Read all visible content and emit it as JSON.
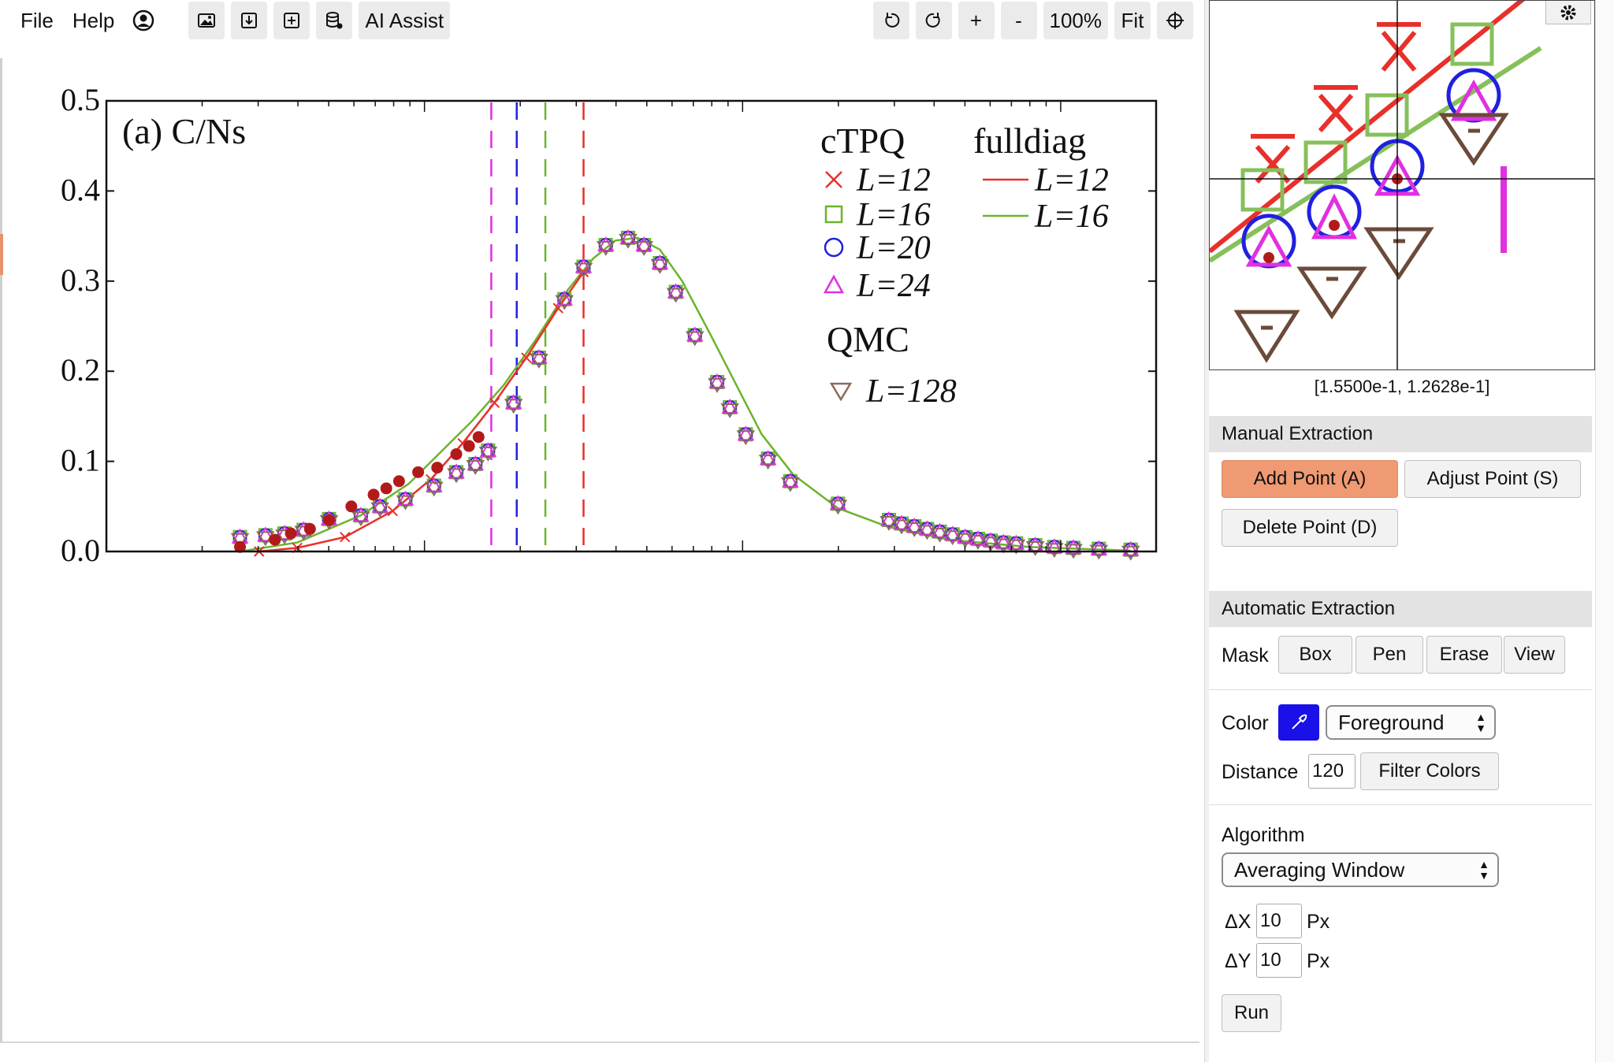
{
  "menu": {
    "file": "File",
    "help": "Help"
  },
  "toolbar": {
    "icons": [
      "account-icon",
      "image-icon",
      "import-icon",
      "add-dataset-icon",
      "dataset-settings-icon"
    ],
    "ai_assist": "AI Assist",
    "undo_icon": "undo-icon",
    "redo_icon": "redo-icon",
    "zoom_in": "+",
    "zoom_out": "-",
    "zoom_level": "100%",
    "fit": "Fit",
    "crosshair_icon": "crosshair-icon"
  },
  "chart_data": {
    "type": "scatter",
    "panel_label": "(a) C/Ns",
    "xscale": "log",
    "ylim": [
      0.0,
      0.5
    ],
    "yticks": [
      "0.0",
      "0.1",
      "0.2",
      "0.3",
      "0.4",
      "0.5"
    ],
    "legend": {
      "ctpq_title": "cTPQ",
      "fulldiag_title": "fulldiag",
      "qmc_title": "QMC",
      "entries": [
        {
          "group": "cTPQ",
          "label": "L=12",
          "marker": "x",
          "color": "#e8302a"
        },
        {
          "group": "cTPQ",
          "label": "L=16",
          "marker": "square",
          "color": "#6cb42c"
        },
        {
          "group": "cTPQ",
          "label": "L=20",
          "marker": "circle",
          "color": "#2020e0"
        },
        {
          "group": "cTPQ",
          "label": "L=24",
          "marker": "triangle",
          "color": "#e030e0"
        },
        {
          "group": "fulldiag",
          "label": "L=12",
          "marker": "line",
          "color": "#e8302a"
        },
        {
          "group": "fulldiag",
          "label": "L=16",
          "marker": "line",
          "color": "#6cb42c"
        },
        {
          "group": "QMC",
          "label": "L=128",
          "marker": "triangle-down",
          "color": "#8b6b5a"
        }
      ]
    },
    "vlines": [
      {
        "x_log": -0.79,
        "color": "#e030e0"
      },
      {
        "x_log": -0.71,
        "color": "#2020e0"
      },
      {
        "x_log": -0.62,
        "color": "#6cb42c"
      },
      {
        "x_log": -0.5,
        "color": "#e8302a"
      }
    ],
    "x_log_range": [
      -2.0,
      1.3
    ],
    "curve_log": [
      [
        -1.58,
        0.0
      ],
      [
        -1.4,
        0.01
      ],
      [
        -1.2,
        0.04
      ],
      [
        -1.05,
        0.075
      ],
      [
        -0.95,
        0.11
      ],
      [
        -0.85,
        0.145
      ],
      [
        -0.75,
        0.185
      ],
      [
        -0.65,
        0.235
      ],
      [
        -0.55,
        0.29
      ],
      [
        -0.47,
        0.325
      ],
      [
        -0.4,
        0.345
      ],
      [
        -0.33,
        0.348
      ],
      [
        -0.26,
        0.335
      ],
      [
        -0.19,
        0.3
      ],
      [
        -0.1,
        0.24
      ],
      [
        -0.02,
        0.185
      ],
      [
        0.06,
        0.13
      ],
      [
        0.16,
        0.085
      ],
      [
        0.3,
        0.048
      ],
      [
        0.46,
        0.027
      ],
      [
        0.65,
        0.013
      ],
      [
        0.9,
        0.005
      ],
      [
        1.22,
        0.001
      ]
    ],
    "L12_line_log": [
      [
        -1.52,
        0.0
      ],
      [
        -1.4,
        0.004
      ],
      [
        -1.25,
        0.016
      ],
      [
        -1.1,
        0.045
      ],
      [
        -0.98,
        0.08
      ],
      [
        -0.88,
        0.12
      ],
      [
        -0.78,
        0.165
      ],
      [
        -0.68,
        0.215
      ],
      [
        -0.58,
        0.27
      ],
      [
        -0.5,
        0.31
      ]
    ],
    "qmc_points_log": [
      [
        -1.58,
        0.016
      ],
      [
        -1.5,
        0.018
      ],
      [
        -1.44,
        0.02
      ],
      [
        -1.38,
        0.024
      ],
      [
        -1.3,
        0.036
      ],
      [
        -1.2,
        0.04
      ],
      [
        -1.14,
        0.05
      ],
      [
        -1.06,
        0.058
      ],
      [
        -0.97,
        0.073
      ],
      [
        -0.9,
        0.088
      ],
      [
        -0.84,
        0.097
      ],
      [
        -0.8,
        0.112
      ],
      [
        -0.72,
        0.165
      ],
      [
        -0.64,
        0.215
      ],
      [
        -0.56,
        0.28
      ],
      [
        -0.5,
        0.316
      ],
      [
        -0.43,
        0.34
      ],
      [
        -0.36,
        0.348
      ],
      [
        -0.31,
        0.34
      ],
      [
        -0.26,
        0.32
      ],
      [
        -0.21,
        0.288
      ],
      [
        -0.15,
        0.24
      ],
      [
        -0.08,
        0.188
      ],
      [
        -0.04,
        0.16
      ],
      [
        0.01,
        0.13
      ],
      [
        0.08,
        0.103
      ],
      [
        0.15,
        0.078
      ],
      [
        0.3,
        0.053
      ],
      [
        0.46,
        0.035
      ],
      [
        0.5,
        0.031
      ],
      [
        0.54,
        0.028
      ],
      [
        0.58,
        0.025
      ],
      [
        0.62,
        0.022
      ],
      [
        0.66,
        0.019
      ],
      [
        0.7,
        0.016
      ],
      [
        0.74,
        0.014
      ],
      [
        0.78,
        0.012
      ],
      [
        0.82,
        0.01
      ],
      [
        0.86,
        0.009
      ],
      [
        0.92,
        0.007
      ],
      [
        0.98,
        0.005
      ],
      [
        1.04,
        0.004
      ],
      [
        1.12,
        0.003
      ],
      [
        1.22,
        0.002
      ]
    ],
    "extracted_points_log": [
      [
        -1.58,
        0.005
      ],
      [
        -1.47,
        0.013
      ],
      [
        -1.42,
        0.02
      ],
      [
        -1.36,
        0.025
      ],
      [
        -1.3,
        0.035
      ],
      [
        -1.23,
        0.05
      ],
      [
        -1.16,
        0.063
      ],
      [
        -1.12,
        0.07
      ],
      [
        -1.08,
        0.078
      ],
      [
        -1.02,
        0.088
      ],
      [
        -0.96,
        0.093
      ],
      [
        -0.9,
        0.108
      ],
      [
        -0.86,
        0.117
      ],
      [
        -0.83,
        0.127
      ]
    ],
    "extracted_color": "#b21a1a"
  },
  "magnifier": {
    "coords": "[1.5500e-1, 1.2628e-1]",
    "settings_icon": "gear-icon"
  },
  "manual": {
    "header": "Manual Extraction",
    "add_point": "Add Point (A)",
    "adjust_point": "Adjust Point (S)",
    "delete_point": "Delete Point (D)"
  },
  "auto": {
    "header": "Automatic Extraction",
    "mask_label": "Mask",
    "mask_buttons": [
      "Box",
      "Pen",
      "Erase",
      "View"
    ],
    "color_label": "Color",
    "color_value": "#1a10e8",
    "color_mode": "Foreground",
    "distance_label": "Distance",
    "distance_value": "120",
    "filter_colors": "Filter Colors",
    "algorithm_label": "Algorithm",
    "algorithm_value": "Averaging Window",
    "dx_label": "ΔX",
    "dx_value": "10",
    "dy_label": "ΔY",
    "dy_value": "10",
    "px_unit": "Px",
    "run": "Run"
  }
}
